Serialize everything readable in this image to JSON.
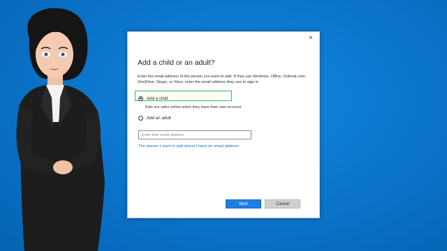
{
  "dialog": {
    "close_glyph": "×",
    "title": "Add a child or an adult?",
    "instructions": "Enter the email address of the person you want to add. If they use Windows, Office, Outlook.com, OneDrive, Skype, or Xbox, enter the email address they use to sign in.",
    "options": [
      {
        "label": "Add a child",
        "selected": true,
        "note": "Kids are safer online when they have their own account"
      },
      {
        "label": "Add an adult",
        "selected": false
      }
    ],
    "email": {
      "placeholder": "Enter their email address",
      "value": ""
    },
    "no_email_link": "The person I want to add doesn't have an email address",
    "buttons": {
      "next": "Next",
      "cancel": "Cancel"
    }
  },
  "colors": {
    "background": "#0a73c9",
    "accent": "#1f7fe0",
    "highlight": "#2fbf3a",
    "link": "#1a6fc4"
  }
}
